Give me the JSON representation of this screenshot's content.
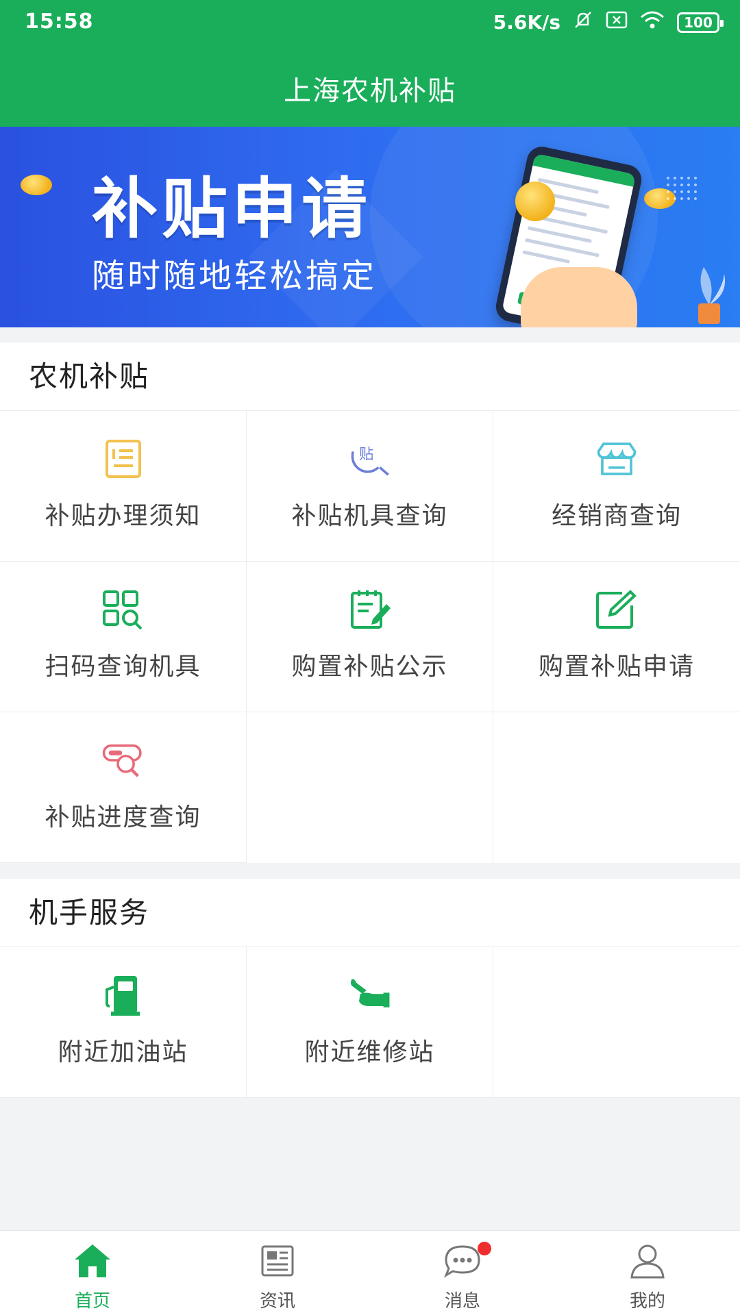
{
  "status_bar": {
    "time": "15:58",
    "network_speed": "5.6K/s",
    "battery": "100",
    "icons": [
      "mute-icon",
      "sim-icon",
      "wifi-icon",
      "battery-icon"
    ]
  },
  "header": {
    "title": "上海农机补贴"
  },
  "banner": {
    "headline": "补贴申请",
    "subline": "随时随地轻松搞定"
  },
  "sections": [
    {
      "title": "农机补贴",
      "items": [
        {
          "label": "补贴办理须知",
          "icon": "notice-doc-icon",
          "color": "#f2c14e"
        },
        {
          "label": "补贴机具查询",
          "icon": "subsidy-search-icon",
          "color": "#6b7fd6"
        },
        {
          "label": "经销商查询",
          "icon": "store-icon",
          "color": "#4fc4d6"
        },
        {
          "label": "扫码查询机具",
          "icon": "scan-search-icon",
          "color": "#1aae5a"
        },
        {
          "label": "购置补贴公示",
          "icon": "publicity-edit-icon",
          "color": "#1aae5a"
        },
        {
          "label": "购置补贴申请",
          "icon": "apply-edit-icon",
          "color": "#1aae5a"
        },
        {
          "label": "补贴进度查询",
          "icon": "progress-search-icon",
          "color": "#e86a7a"
        }
      ]
    },
    {
      "title": "机手服务",
      "items": [
        {
          "label": "附近加油站",
          "icon": "fuel-station-icon",
          "color": "#1aae5a"
        },
        {
          "label": "附近维修站",
          "icon": "repair-wrench-icon",
          "color": "#1aae5a"
        }
      ]
    }
  ],
  "tabs": [
    {
      "label": "首页",
      "icon": "home-icon",
      "active": true
    },
    {
      "label": "资讯",
      "icon": "news-icon",
      "active": false
    },
    {
      "label": "消息",
      "icon": "message-icon",
      "active": false,
      "badge": true
    },
    {
      "label": "我的",
      "icon": "profile-icon",
      "active": false
    }
  ],
  "colors": {
    "primary": "#1aae5a",
    "banner": "#2a5ee8",
    "badge": "#f02d2d"
  }
}
